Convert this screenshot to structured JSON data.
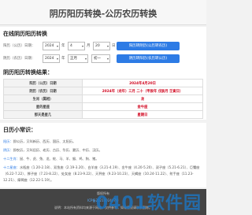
{
  "header": {
    "title": "阴历阳历转换-公历农历转换"
  },
  "form": {
    "section_title": "在线阴历阳历转换",
    "row1": {
      "label": "阳历（公历）日期：",
      "year": "2024",
      "month": "4",
      "day": "20",
      "unit_year": "年",
      "unit_month": "月",
      "unit_day": "日",
      "button": "阳历转阴历(公历转农历)"
    },
    "row2": {
      "label": "阴历（农历）日期：",
      "year": "2024",
      "month": "正月",
      "day": "初一",
      "unit_year": "年",
      "button": "阴历转阳历(农历转公历)"
    }
  },
  "result": {
    "title": "阴历阳历转换结果：",
    "rows": [
      {
        "k": "阳历（公历）日期",
        "v": "2024年4月20日"
      },
      {
        "k": "阴历（农历）日期",
        "v": "2024年（龙年）三月 二十（甲辰年 戊辰月 壬寅日）"
      },
      {
        "k": "生肖（属相）",
        "v": "龙"
      },
      {
        "k": "星的星座",
        "v": "金牛座"
      },
      {
        "k": "那天是星几",
        "v": "星期日"
      }
    ]
  },
  "tips": {
    "title": "日历小常识：",
    "items": [
      {
        "t": "阳历：",
        "text": "即公历，又叫新历、西历、国历、太阳历。"
      },
      {
        "t": "阴历：",
        "text": "即农历，又叫旧历、老历、古历、华历、夏历、中历、汉历。"
      },
      {
        "t": "十二生肖：",
        "text": "鼠、牛、虎、兔、龙、蛇、马、羊、猴、鸡、狗、猪。"
      },
      {
        "t": "十二星座：",
        "text": "水瓶座（1.20-2.18）、双鱼座（2.19-3.20）、白羊座（3.21-4.19）、金牛座（4.20-5.20）、双子座（5.21-6.21）、巨蟹座（6.22-7.22）、狮子座（7.23-8.22）、处女座（8.23-9.22）、天秤座（9.23-10.23）、天蝎座（10.24-11.22）、射手座（11.23-12.21）、摩羯座（12.22-1.19）。"
      }
    ]
  },
  "footer": {
    "line1": "版权所有",
    "line2": "ICP备2021002467号",
    "line3": "说明：本站所有资料均来源于网络，仅供参考，如有侵权请联系删除。"
  },
  "watermark": "0401软件园"
}
